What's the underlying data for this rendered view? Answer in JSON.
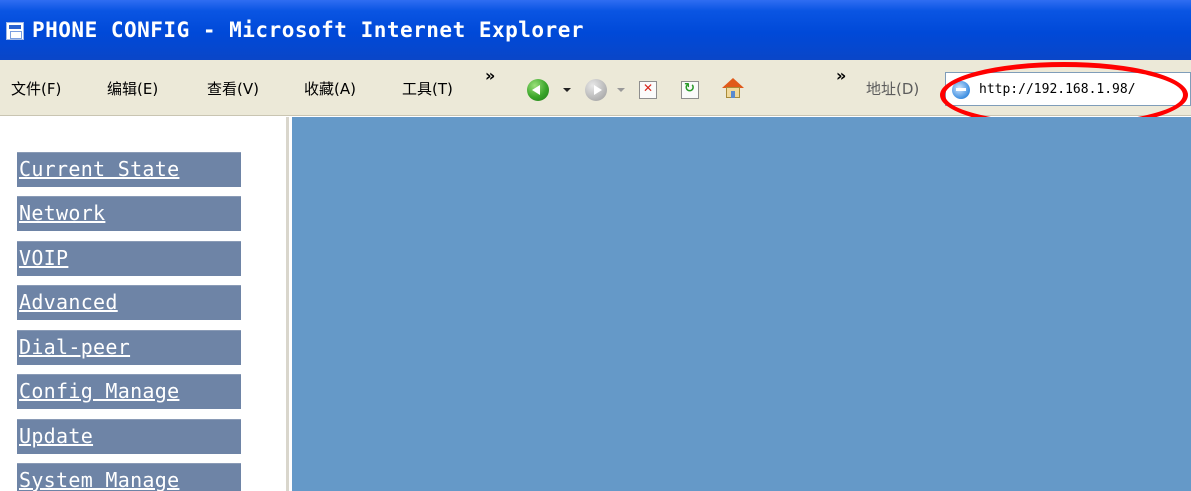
{
  "window": {
    "title": "PHONE CONFIG - Microsoft Internet Explorer"
  },
  "menu": {
    "items": [
      "文件(F)",
      "编辑(E)",
      "查看(V)",
      "收藏(A)",
      "工具(T)"
    ],
    "overflow": "»"
  },
  "toolbar": {
    "overflow": "»",
    "buttons": [
      "back-icon",
      "forward-icon",
      "stop-icon",
      "refresh-icon",
      "home-icon"
    ]
  },
  "address": {
    "label": "地址(D)",
    "value": "http://192.168.1.98/"
  },
  "nav": {
    "items": [
      {
        "label": "Current State"
      },
      {
        "label": "Network"
      },
      {
        "label": "VOIP"
      },
      {
        "label": "Advanced"
      },
      {
        "label": "Dial-peer"
      },
      {
        "label": "Config Manage"
      },
      {
        "label": "Update"
      },
      {
        "label": "System Manage"
      }
    ]
  },
  "colors": {
    "titlebar": "#0a55e3",
    "nav_item": "#6e84a6",
    "content_bg": "#6599c8",
    "highlight": "#ff0000"
  }
}
